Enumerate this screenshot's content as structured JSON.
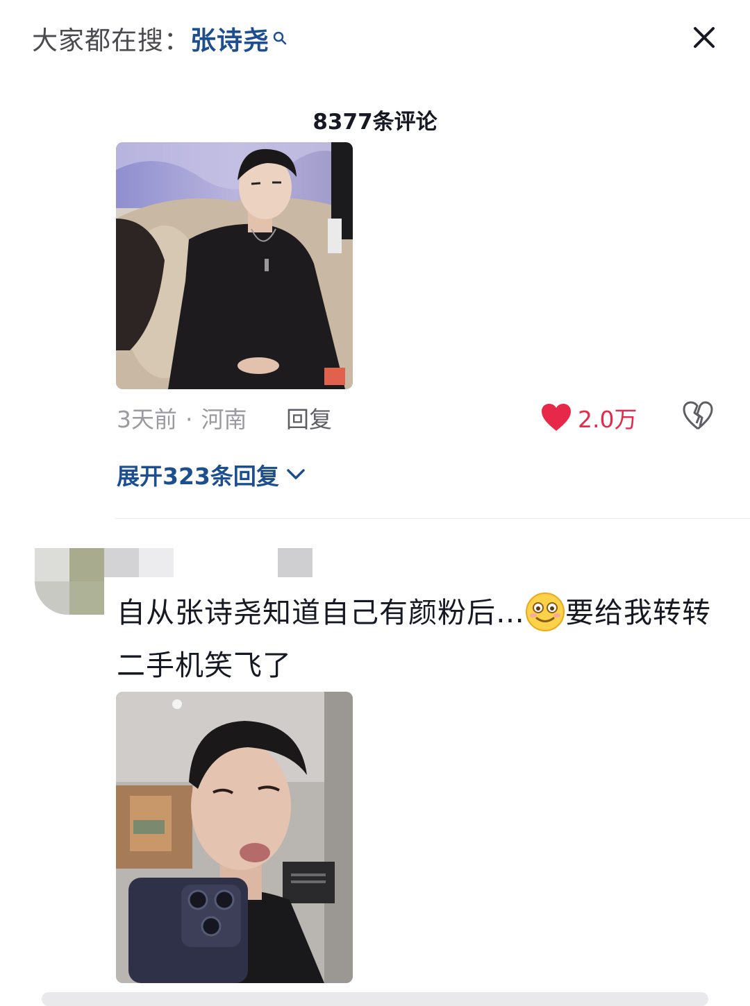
{
  "header": {
    "search_prefix": "大家都在搜：",
    "search_term": "张诗尧"
  },
  "comments": {
    "count_label": "8377条评论"
  },
  "comment1": {
    "time": "3天前",
    "separator": "·",
    "location": "河南",
    "reply_label": "回复",
    "likes": "2.0万",
    "expand_label": "展开323条回复"
  },
  "comment2": {
    "text_part1": "自从张诗尧知道自己有颜粉后…",
    "text_part2": "要给我转转二手机笑飞了"
  },
  "colors": {
    "accent_blue": "#1d4e8f",
    "like_red": "#e8284b",
    "meta_gray": "#9a9aa1"
  },
  "icons": [
    "search-icon",
    "close-icon",
    "heart-icon",
    "broken-heart-icon",
    "chevron-down-icon",
    "smile-emoji"
  ]
}
